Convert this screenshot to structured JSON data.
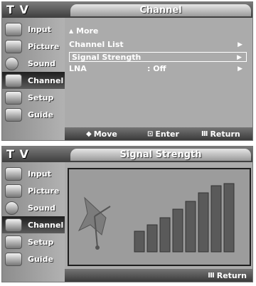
{
  "top": {
    "tv_title": "T V",
    "header_tab": "Channel",
    "sidebar": [
      {
        "label": "Input",
        "icon": "input-icon",
        "active": false
      },
      {
        "label": "Picture",
        "icon": "picture-icon",
        "active": false
      },
      {
        "label": "Sound",
        "icon": "sound-icon",
        "active": false
      },
      {
        "label": "Channel",
        "icon": "channel-icon",
        "active": true
      },
      {
        "label": "Setup",
        "icon": "setup-icon",
        "active": false
      },
      {
        "label": "Guide",
        "icon": "guide-icon",
        "active": false
      }
    ],
    "menu": {
      "more": "More",
      "items": [
        {
          "label": "Channel List",
          "value": "",
          "selected": false
        },
        {
          "label": "Signal Strength",
          "value": "",
          "selected": true
        },
        {
          "label": "LNA",
          "value": ": Off",
          "selected": false
        }
      ]
    },
    "footer": {
      "move": "Move",
      "enter": "Enter",
      "return": "Return",
      "move_icon": "updown-icon",
      "enter_icon": "enter-icon",
      "return_icon": "return-icon"
    }
  },
  "bottom": {
    "tv_title": "T V",
    "header_tab": "Signal Strength",
    "sidebar": [
      {
        "label": "Input",
        "icon": "input-icon",
        "active": false
      },
      {
        "label": "Picture",
        "icon": "picture-icon",
        "active": false
      },
      {
        "label": "Sound",
        "icon": "sound-icon",
        "active": false
      },
      {
        "label": "Channel",
        "icon": "channel-icon",
        "active": true
      },
      {
        "label": "Setup",
        "icon": "setup-icon",
        "active": false
      },
      {
        "label": "Guide",
        "icon": "guide-icon",
        "active": false
      }
    ],
    "signal_bar_levels": [
      0.3,
      0.4,
      0.5,
      0.62,
      0.74,
      0.86,
      0.97,
      1.0
    ],
    "footer": {
      "return": "Return",
      "return_icon": "return-icon"
    }
  },
  "colors": {
    "active_item": "#2b2b2b",
    "bars": "#5a5a5a",
    "panel": "#9c9c9c"
  }
}
